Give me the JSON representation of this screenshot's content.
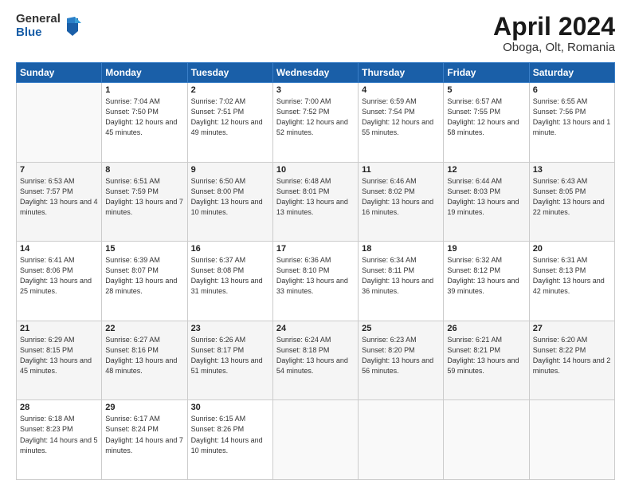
{
  "header": {
    "logo_general": "General",
    "logo_blue": "Blue",
    "title": "April 2024",
    "location": "Oboga, Olt, Romania"
  },
  "weekdays": [
    "Sunday",
    "Monday",
    "Tuesday",
    "Wednesday",
    "Thursday",
    "Friday",
    "Saturday"
  ],
  "weeks": [
    [
      {
        "day": "",
        "empty": true
      },
      {
        "day": "1",
        "sunrise": "Sunrise: 7:04 AM",
        "sunset": "Sunset: 7:50 PM",
        "daylight": "Daylight: 12 hours and 45 minutes."
      },
      {
        "day": "2",
        "sunrise": "Sunrise: 7:02 AM",
        "sunset": "Sunset: 7:51 PM",
        "daylight": "Daylight: 12 hours and 49 minutes."
      },
      {
        "day": "3",
        "sunrise": "Sunrise: 7:00 AM",
        "sunset": "Sunset: 7:52 PM",
        "daylight": "Daylight: 12 hours and 52 minutes."
      },
      {
        "day": "4",
        "sunrise": "Sunrise: 6:59 AM",
        "sunset": "Sunset: 7:54 PM",
        "daylight": "Daylight: 12 hours and 55 minutes."
      },
      {
        "day": "5",
        "sunrise": "Sunrise: 6:57 AM",
        "sunset": "Sunset: 7:55 PM",
        "daylight": "Daylight: 12 hours and 58 minutes."
      },
      {
        "day": "6",
        "sunrise": "Sunrise: 6:55 AM",
        "sunset": "Sunset: 7:56 PM",
        "daylight": "Daylight: 13 hours and 1 minute."
      }
    ],
    [
      {
        "day": "7",
        "sunrise": "Sunrise: 6:53 AM",
        "sunset": "Sunset: 7:57 PM",
        "daylight": "Daylight: 13 hours and 4 minutes."
      },
      {
        "day": "8",
        "sunrise": "Sunrise: 6:51 AM",
        "sunset": "Sunset: 7:59 PM",
        "daylight": "Daylight: 13 hours and 7 minutes."
      },
      {
        "day": "9",
        "sunrise": "Sunrise: 6:50 AM",
        "sunset": "Sunset: 8:00 PM",
        "daylight": "Daylight: 13 hours and 10 minutes."
      },
      {
        "day": "10",
        "sunrise": "Sunrise: 6:48 AM",
        "sunset": "Sunset: 8:01 PM",
        "daylight": "Daylight: 13 hours and 13 minutes."
      },
      {
        "day": "11",
        "sunrise": "Sunrise: 6:46 AM",
        "sunset": "Sunset: 8:02 PM",
        "daylight": "Daylight: 13 hours and 16 minutes."
      },
      {
        "day": "12",
        "sunrise": "Sunrise: 6:44 AM",
        "sunset": "Sunset: 8:03 PM",
        "daylight": "Daylight: 13 hours and 19 minutes."
      },
      {
        "day": "13",
        "sunrise": "Sunrise: 6:43 AM",
        "sunset": "Sunset: 8:05 PM",
        "daylight": "Daylight: 13 hours and 22 minutes."
      }
    ],
    [
      {
        "day": "14",
        "sunrise": "Sunrise: 6:41 AM",
        "sunset": "Sunset: 8:06 PM",
        "daylight": "Daylight: 13 hours and 25 minutes."
      },
      {
        "day": "15",
        "sunrise": "Sunrise: 6:39 AM",
        "sunset": "Sunset: 8:07 PM",
        "daylight": "Daylight: 13 hours and 28 minutes."
      },
      {
        "day": "16",
        "sunrise": "Sunrise: 6:37 AM",
        "sunset": "Sunset: 8:08 PM",
        "daylight": "Daylight: 13 hours and 31 minutes."
      },
      {
        "day": "17",
        "sunrise": "Sunrise: 6:36 AM",
        "sunset": "Sunset: 8:10 PM",
        "daylight": "Daylight: 13 hours and 33 minutes."
      },
      {
        "day": "18",
        "sunrise": "Sunrise: 6:34 AM",
        "sunset": "Sunset: 8:11 PM",
        "daylight": "Daylight: 13 hours and 36 minutes."
      },
      {
        "day": "19",
        "sunrise": "Sunrise: 6:32 AM",
        "sunset": "Sunset: 8:12 PM",
        "daylight": "Daylight: 13 hours and 39 minutes."
      },
      {
        "day": "20",
        "sunrise": "Sunrise: 6:31 AM",
        "sunset": "Sunset: 8:13 PM",
        "daylight": "Daylight: 13 hours and 42 minutes."
      }
    ],
    [
      {
        "day": "21",
        "sunrise": "Sunrise: 6:29 AM",
        "sunset": "Sunset: 8:15 PM",
        "daylight": "Daylight: 13 hours and 45 minutes."
      },
      {
        "day": "22",
        "sunrise": "Sunrise: 6:27 AM",
        "sunset": "Sunset: 8:16 PM",
        "daylight": "Daylight: 13 hours and 48 minutes."
      },
      {
        "day": "23",
        "sunrise": "Sunrise: 6:26 AM",
        "sunset": "Sunset: 8:17 PM",
        "daylight": "Daylight: 13 hours and 51 minutes."
      },
      {
        "day": "24",
        "sunrise": "Sunrise: 6:24 AM",
        "sunset": "Sunset: 8:18 PM",
        "daylight": "Daylight: 13 hours and 54 minutes."
      },
      {
        "day": "25",
        "sunrise": "Sunrise: 6:23 AM",
        "sunset": "Sunset: 8:20 PM",
        "daylight": "Daylight: 13 hours and 56 minutes."
      },
      {
        "day": "26",
        "sunrise": "Sunrise: 6:21 AM",
        "sunset": "Sunset: 8:21 PM",
        "daylight": "Daylight: 13 hours and 59 minutes."
      },
      {
        "day": "27",
        "sunrise": "Sunrise: 6:20 AM",
        "sunset": "Sunset: 8:22 PM",
        "daylight": "Daylight: 14 hours and 2 minutes."
      }
    ],
    [
      {
        "day": "28",
        "sunrise": "Sunrise: 6:18 AM",
        "sunset": "Sunset: 8:23 PM",
        "daylight": "Daylight: 14 hours and 5 minutes."
      },
      {
        "day": "29",
        "sunrise": "Sunrise: 6:17 AM",
        "sunset": "Sunset: 8:24 PM",
        "daylight": "Daylight: 14 hours and 7 minutes."
      },
      {
        "day": "30",
        "sunrise": "Sunrise: 6:15 AM",
        "sunset": "Sunset: 8:26 PM",
        "daylight": "Daylight: 14 hours and 10 minutes."
      },
      {
        "day": "",
        "empty": true
      },
      {
        "day": "",
        "empty": true
      },
      {
        "day": "",
        "empty": true
      },
      {
        "day": "",
        "empty": true
      }
    ]
  ]
}
